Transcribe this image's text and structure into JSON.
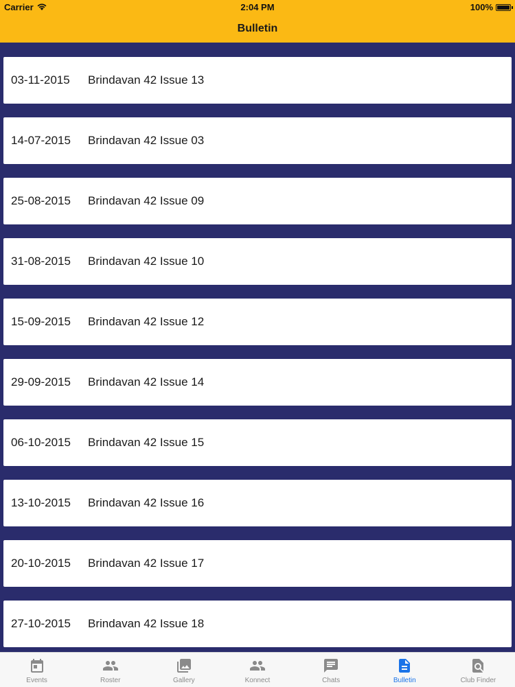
{
  "status_bar": {
    "carrier": "Carrier",
    "time": "2:04 PM",
    "battery": "100%"
  },
  "nav": {
    "title": "Bulletin"
  },
  "bulletins": [
    {
      "date": "03-11-2015",
      "title": "Brindavan 42 Issue 13"
    },
    {
      "date": "14-07-2015",
      "title": "Brindavan 42 Issue 03"
    },
    {
      "date": "25-08-2015",
      "title": "Brindavan 42 Issue 09"
    },
    {
      "date": "31-08-2015",
      "title": "Brindavan 42 Issue 10"
    },
    {
      "date": "15-09-2015",
      "title": "Brindavan 42 Issue 12"
    },
    {
      "date": "29-09-2015",
      "title": "Brindavan 42 Issue 14"
    },
    {
      "date": "06-10-2015",
      "title": "Brindavan 42 Issue 15"
    },
    {
      "date": "13-10-2015",
      "title": "Brindavan 42 Issue 16"
    },
    {
      "date": "20-10-2015",
      "title": "Brindavan 42 Issue 17"
    },
    {
      "date": "27-10-2015",
      "title": "Brindavan 42 Issue 18"
    }
  ],
  "tabs": [
    {
      "label": "Events",
      "icon": "calendar-icon"
    },
    {
      "label": "Roster",
      "icon": "people-icon"
    },
    {
      "label": "Gallery",
      "icon": "gallery-icon"
    },
    {
      "label": "Konnect",
      "icon": "people-icon"
    },
    {
      "label": "Chats",
      "icon": "chat-icon"
    },
    {
      "label": "Bulletin",
      "icon": "document-icon"
    },
    {
      "label": "Club Finder",
      "icon": "search-document-icon"
    }
  ],
  "active_tab": "Bulletin",
  "colors": {
    "header": "#fbb914",
    "background": "#2a2c6c",
    "active_tab": "#1a73e8"
  }
}
